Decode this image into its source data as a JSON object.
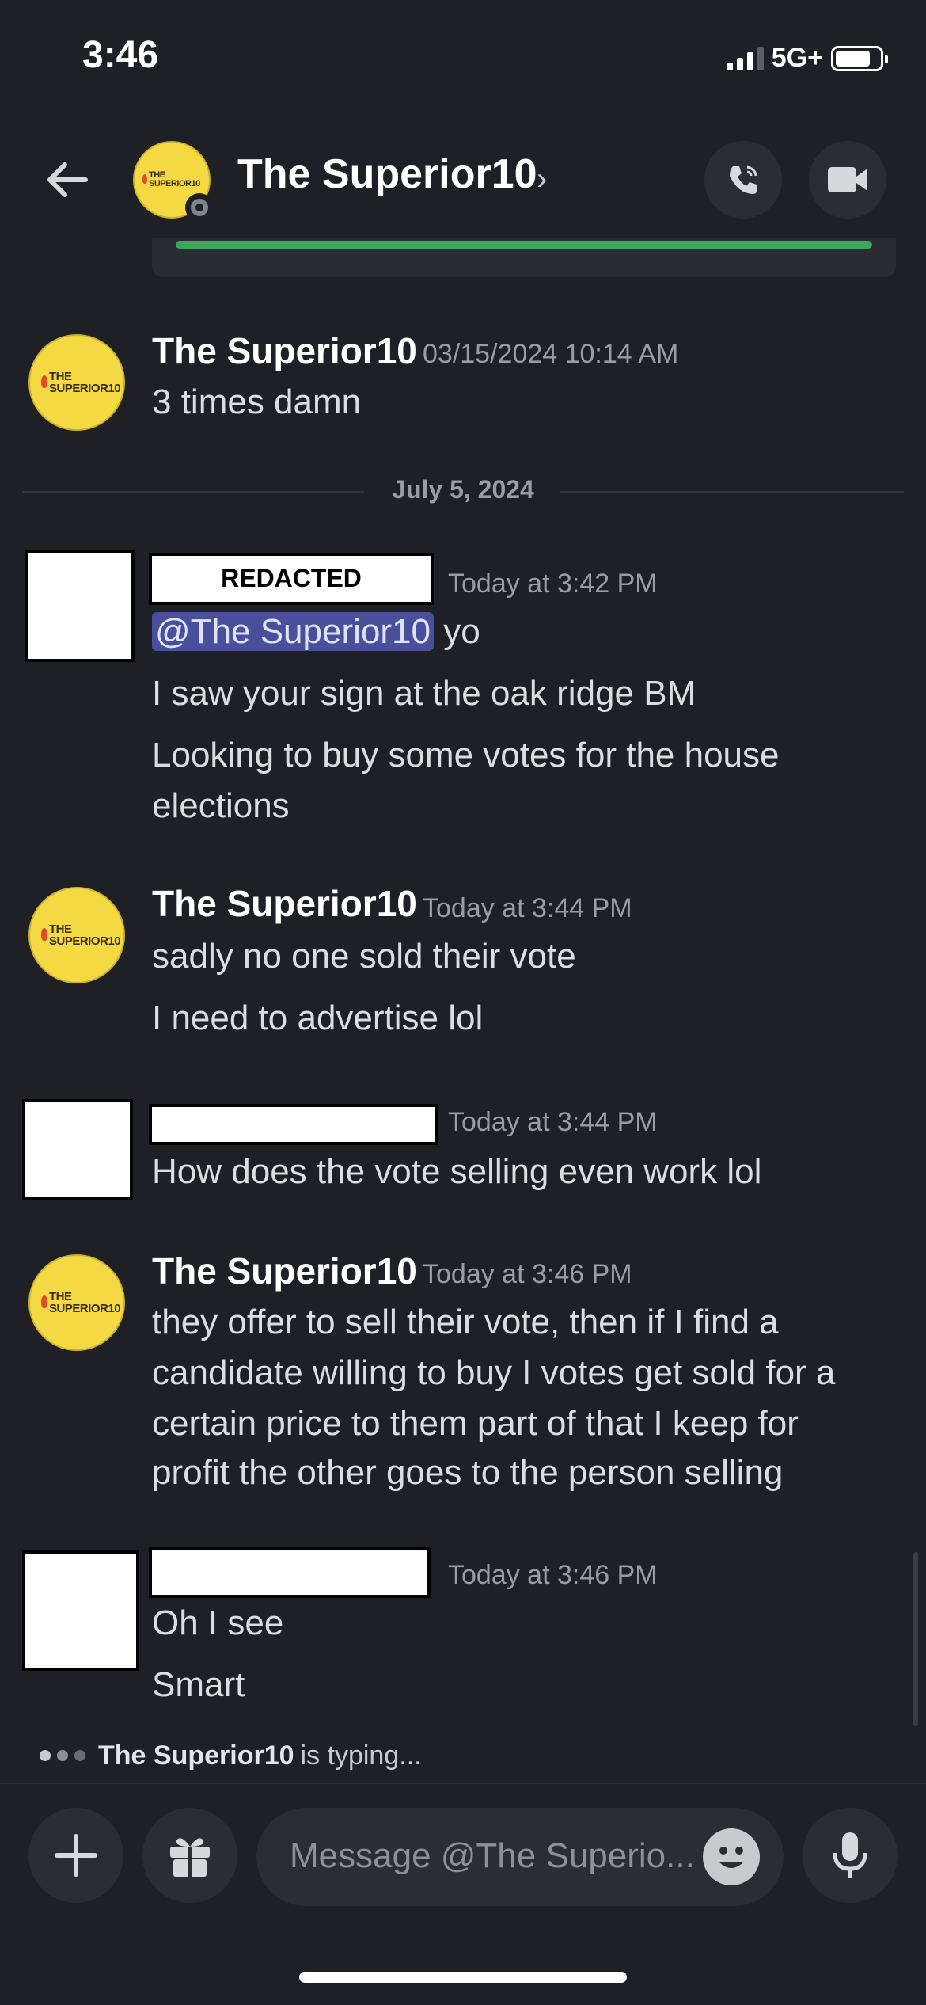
{
  "status_bar": {
    "time": "3:46",
    "network": "5G+",
    "battery_level": 0.8
  },
  "header": {
    "title": "The Superior10",
    "chevron": "›"
  },
  "avatar_logo_text": "THE SUPERIOR10",
  "date_divider": "July 5, 2024",
  "messages": [
    {
      "author": "The Superior10",
      "timestamp": "03/15/2024 10:14 AM",
      "lines": [
        "3 times damn"
      ]
    },
    {
      "author": "REDACTED",
      "timestamp": "Today at 3:42 PM",
      "mention": "@The Superior10",
      "mention_rest": " yo",
      "lines": [
        "I saw your sign at the oak ridge BM",
        "Looking to buy some votes for the house",
        "elections"
      ]
    },
    {
      "author": "The Superior10",
      "timestamp": "Today at 3:44 PM",
      "lines": [
        "sadly no one sold their vote",
        "I need to advertise lol"
      ]
    },
    {
      "author": "",
      "timestamp": "Today at 3:44 PM",
      "lines": [
        "How does the vote selling even work lol"
      ]
    },
    {
      "author": "The Superior10",
      "timestamp": "Today at 3:46 PM",
      "lines": [
        "they offer to sell their vote, then if I find a",
        "candidate willing to buy I votes get sold for a",
        "certain price to them part of that I keep for",
        "profit the other goes to the person selling"
      ]
    },
    {
      "author": "",
      "timestamp": "Today at 3:46 PM",
      "lines": [
        "Oh I see",
        "Smart"
      ]
    }
  ],
  "typing": {
    "name": "The Superior10",
    "text": " is typing..."
  },
  "composer": {
    "placeholder": "Message @The Superio..."
  },
  "icons": {
    "back": "arrow-left-icon",
    "call": "phone-icon",
    "video": "video-camera-icon",
    "add": "plus-icon",
    "gift": "gift-icon",
    "emoji": "emoji-icon",
    "mic": "microphone-icon"
  },
  "colors": {
    "background": "#1f2025",
    "mention_bg": "#4a4f9c",
    "logo_yellow": "#f5d943",
    "embed_accent": "#3ea55c"
  }
}
